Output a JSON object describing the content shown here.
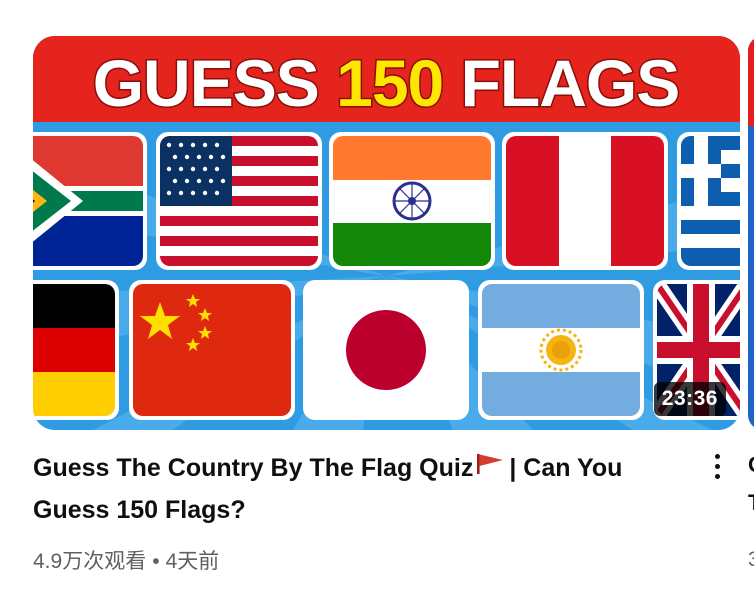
{
  "video": {
    "thumbnail_text_part1": "GUESS",
    "thumbnail_text_number": "150",
    "thumbnail_text_part2": "FLAGS",
    "duration": "23:36",
    "title_part1": "Guess The Country By The Flag Quiz",
    "title_part2": "| Can You",
    "title_line2": "Guess 150 Flags?",
    "views": "4.9万次观看",
    "separator": "•",
    "age": "4天前",
    "flags_row1": [
      "South Africa",
      "United States",
      "India",
      "Peru",
      "Greece"
    ],
    "flags_row2": [
      "Germany",
      "China",
      "Japan",
      "Argentina",
      "United Kingdom"
    ]
  },
  "next_card": {
    "title_line1": "G",
    "title_line2": "T",
    "meta": "3"
  },
  "colors": {
    "banner_red": "#e4241d",
    "number_yellow": "#ffe600",
    "background_blue": "#2f9be3",
    "title_text": "#0f0f0f",
    "meta_text": "#606060"
  }
}
